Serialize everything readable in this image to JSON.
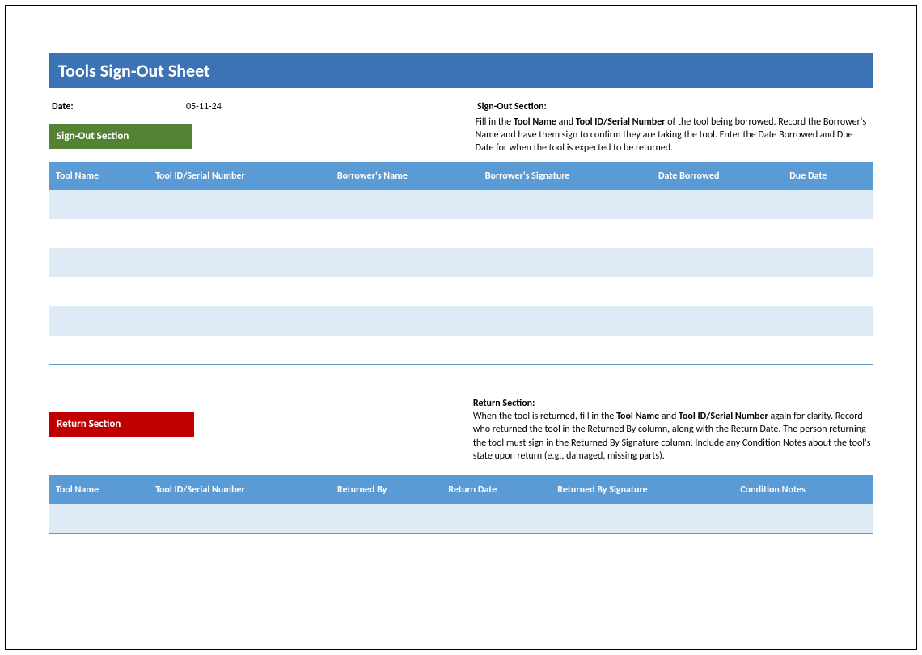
{
  "title": "Tools Sign-Out Sheet",
  "date_label": "Date:",
  "date_value": "05-11-24",
  "sign_out": {
    "chip": "Sign-Out Section",
    "instr_title": "Sign-Out Section",
    "instr_pre": "Fill in the ",
    "instr_b1": "Tool Name",
    "instr_mid1": " and ",
    "instr_b2": "Tool ID/Serial Number",
    "instr_post": " of the tool being borrowed. Record the Borrower's Name and have them sign to confirm they are taking the tool. Enter the Date Borrowed and Due Date for when the tool is expected to be returned.",
    "headers": {
      "c1": "Tool Name",
      "c2": "Tool ID/Serial Number",
      "c3": "Borrower's Name",
      "c4": "Borrower's Signature",
      "c5": "Date Borrowed",
      "c6": "Due Date"
    }
  },
  "return": {
    "chip": "Return Section",
    "instr_title": "Return Section",
    "instr_pre": "When the tool is returned, fill in the ",
    "instr_b1": "Tool Name",
    "instr_mid1": " and ",
    "instr_b2": "Tool ID/Serial Number",
    "instr_post": " again for clarity. Record who returned the tool in the Returned By column, along with the Return Date. The person returning the tool must sign in the Returned By Signature column. Include any Condition Notes about the tool's state upon return (e.g., damaged, missing parts).",
    "headers": {
      "c1": "Tool Name",
      "c2": "Tool ID/Serial Number",
      "c3": "Returned By",
      "c4": "Return Date",
      "c5": "Returned By Signature",
      "c6": "Condition Notes"
    }
  }
}
